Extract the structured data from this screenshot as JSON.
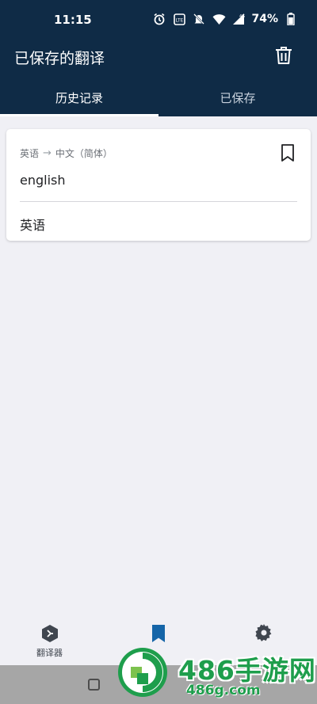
{
  "status_bar": {
    "time": "11:15",
    "battery": "74%",
    "network": "4G"
  },
  "header": {
    "title": "已保存的翻译"
  },
  "tabs": [
    {
      "label": "历史记录",
      "active": true
    },
    {
      "label": "已保存",
      "active": false
    }
  ],
  "card": {
    "source_lang": "英语",
    "target_lang": "中文（简体）",
    "source_text": "english",
    "translated_text": "英语"
  },
  "bottom_nav": {
    "items": [
      {
        "label": "翻译器",
        "icon": "translator-icon"
      },
      {
        "label": "",
        "icon": "bookmark-icon"
      },
      {
        "label": "",
        "icon": "gear-icon"
      }
    ]
  },
  "watermark": {
    "title": "486手游网",
    "url": "486g.com"
  },
  "colors": {
    "header_bg": "#0f2b46",
    "accent": "#1565a8",
    "watermark": "#1e9e4c"
  }
}
